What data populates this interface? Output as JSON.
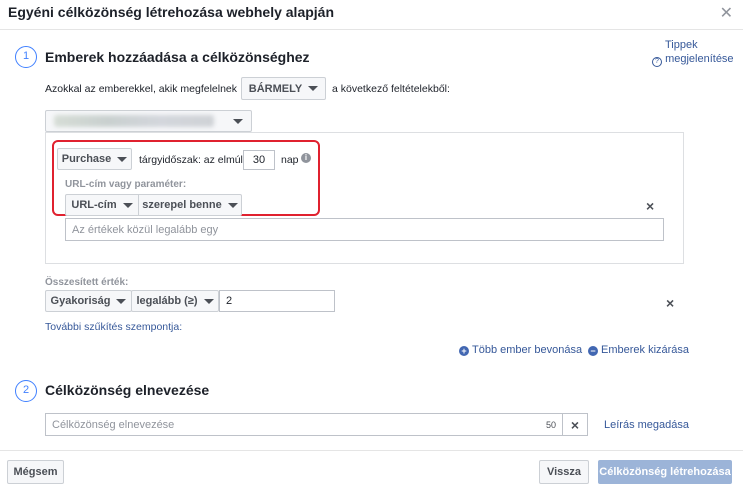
{
  "dialog": {
    "title": "Egyéni célközönség létrehozása webhely alapján",
    "tips_link_line1": "Tippek",
    "tips_link_line2": "megjelenítése"
  },
  "step1": {
    "number": "1",
    "title": "Emberek hozzáadása a célközönséghez",
    "match_prefix": "Azokkal az emberekkel, akik megfelelnek",
    "match_dropdown": "BÁRMELY",
    "match_suffix": "a következő feltételekből:",
    "rule": {
      "event_dropdown": "Purchase",
      "retention_label": "tárgyidőszak: az elmúlt",
      "retention_value": "30",
      "retention_unit": "nap",
      "url_param_label": "URL-cím vagy paraméter:",
      "url_dropdown": "URL-cím",
      "condition_dropdown": "szerepel benne",
      "values_placeholder": "Az értékek közül legalább egy"
    },
    "aggregate": {
      "label": "Összesített érték:",
      "metric_dropdown": "Gyakoriság",
      "operator_dropdown": "legalább (≥)",
      "value": "2"
    },
    "more_refinement_link": "További szűkítés szempontja:",
    "include_more_link": "Több ember bevonása",
    "exclude_link": "Emberek kizárása"
  },
  "step2": {
    "number": "2",
    "title": "Célközönség elnevezése",
    "name_placeholder": "Célközönség elnevezése",
    "char_count": "50",
    "description_link": "Leírás megadása"
  },
  "footer": {
    "cancel": "Mégsem",
    "back": "Vissza",
    "create": "Célközönség létrehozása"
  },
  "colors": {
    "accent": "#4080ff",
    "link": "#365899",
    "highlight_border": "#e0212f",
    "primary_disabled": "#9cb4d8"
  }
}
